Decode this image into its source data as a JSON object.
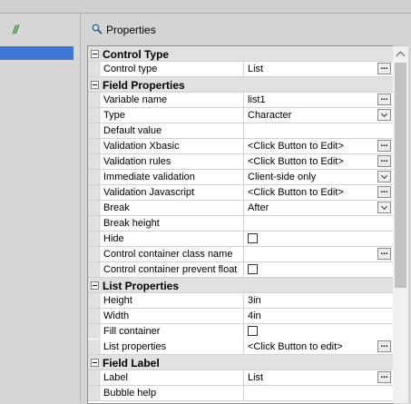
{
  "colors": {
    "accent": "#3d79d4",
    "slash_icon": "#2e8b2e"
  },
  "toolbar": {
    "left_icon": "slash-icon",
    "slash_glyph": "//"
  },
  "panel": {
    "title": "Properties",
    "icon": "magnifier-icon"
  },
  "categories": [
    {
      "label": "Control Type",
      "rows": [
        {
          "name": "Control type",
          "value": "List",
          "editor": "ellipsis"
        }
      ]
    },
    {
      "label": "Field Properties",
      "rows": [
        {
          "name": "Variable name",
          "value": "list1",
          "editor": "ellipsis"
        },
        {
          "name": "Type",
          "value": "Character",
          "editor": "dropdown"
        },
        {
          "name": "Default value",
          "value": "",
          "editor": "none"
        },
        {
          "name": "Validation Xbasic",
          "value": "<Click Button to Edit>",
          "editor": "ellipsis"
        },
        {
          "name": "Validation rules",
          "value": "<Click Button to Edit>",
          "editor": "ellipsis"
        },
        {
          "name": "Immediate validation",
          "value": "Client-side only",
          "editor": "dropdown"
        },
        {
          "name": "Validation Javascript",
          "value": "<Click Button to Edit>",
          "editor": "ellipsis"
        },
        {
          "name": "Break",
          "value": "After",
          "editor": "dropdown"
        },
        {
          "name": "Break height",
          "value": "",
          "editor": "none"
        },
        {
          "name": "Hide",
          "value": "",
          "editor": "checkbox"
        },
        {
          "name": "Control container class name",
          "value": "",
          "editor": "ellipsis"
        },
        {
          "name": "Control container prevent float",
          "value": "",
          "editor": "checkbox"
        }
      ]
    },
    {
      "label": "List Properties",
      "rows": [
        {
          "name": "Height",
          "value": "3in",
          "editor": "none"
        },
        {
          "name": "Width",
          "value": "4in",
          "editor": "none"
        },
        {
          "name": "Fill container",
          "value": "",
          "editor": "checkbox"
        },
        {
          "name": "List properties",
          "value": "<Click Button to edit>",
          "editor": "ellipsis"
        }
      ]
    },
    {
      "label": "Field Label",
      "rows": [
        {
          "name": "Label",
          "value": "List",
          "editor": "ellipsis"
        },
        {
          "name": "Bubble help",
          "value": "",
          "editor": "none"
        }
      ]
    }
  ]
}
